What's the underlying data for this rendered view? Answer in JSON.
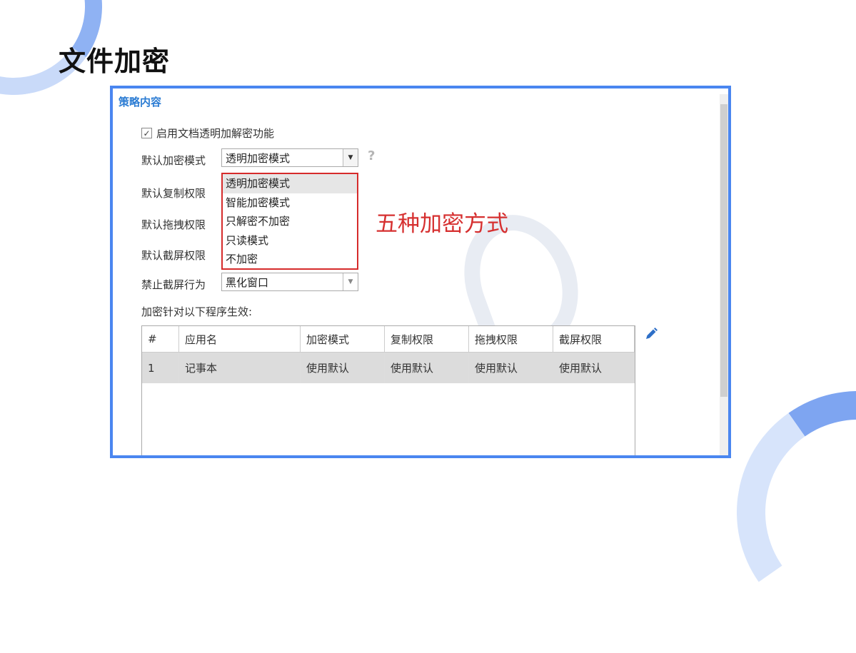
{
  "page": {
    "title": "文件加密"
  },
  "policy": {
    "section_title": "策略内容",
    "enable_checkbox": {
      "checked": true,
      "label": "启用文档透明加解密功能"
    },
    "default_encrypt_mode": {
      "label": "默认加密模式",
      "value": "透明加密模式"
    },
    "default_copy_label": "默认复制权限",
    "default_drag_label": "默认拖拽权限",
    "default_screenshot_label": "默认截屏权限",
    "forbid_screenshot": {
      "label": "禁止截屏行为",
      "value": "黑化窗口"
    },
    "help_icon": "question-icon",
    "dropdown_options": [
      "透明加密模式",
      "智能加密模式",
      "只解密不加密",
      "只读模式",
      "不加密"
    ],
    "callout": "五种加密方式",
    "apply_label": "加密针对以下程序生效:",
    "table": {
      "columns": [
        "#",
        "应用名",
        "加密模式",
        "复制权限",
        "拖拽权限",
        "截屏权限"
      ],
      "rows": [
        [
          "1",
          "记事本",
          "使用默认",
          "使用默认",
          "使用默认",
          "使用默认"
        ]
      ]
    },
    "edit_icon": "pencil-icon"
  },
  "colors": {
    "frame": "#4a86f0",
    "section_title": "#2b7cd3",
    "callout": "#d63030",
    "highlight_border": "#d62b2b"
  }
}
